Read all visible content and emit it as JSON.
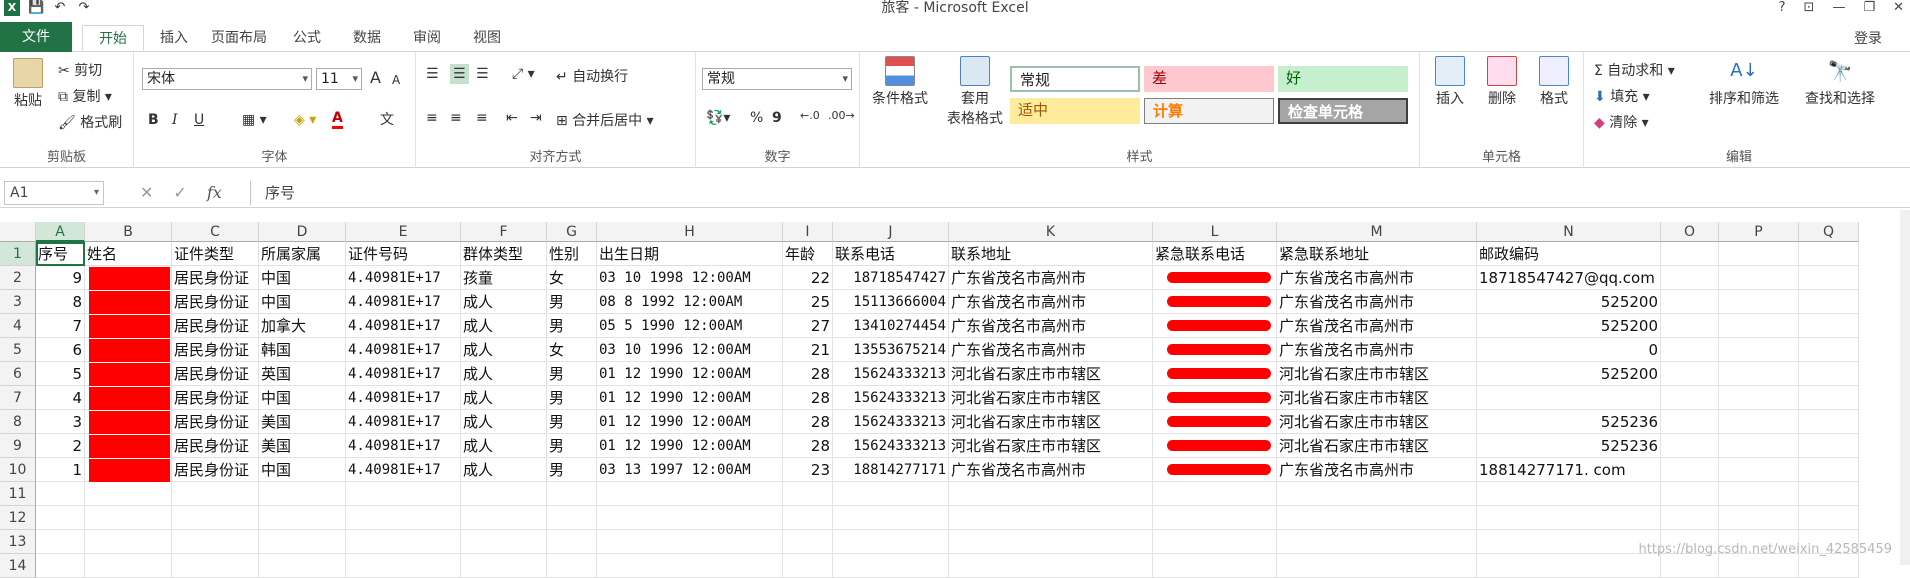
{
  "title_bar": {
    "title": "旅客 - Microsoft Excel",
    "help": "?",
    "ribbon_opts": "⊡",
    "minimize": "—",
    "restore": "❐",
    "close": "✕"
  },
  "tabs": {
    "file": "文件",
    "items": [
      "开始",
      "插入",
      "页面布局",
      "公式",
      "数据",
      "审阅",
      "视图"
    ],
    "login": "登录"
  },
  "ribbon": {
    "clipboard": {
      "paste": "粘贴",
      "cut": "剪切",
      "copy": "复制",
      "format_painter": "格式刷",
      "label": "剪贴板"
    },
    "font": {
      "name": "宋体",
      "size": "11",
      "grow": "A",
      "shrink": "A",
      "bold": "B",
      "italic": "I",
      "underline": "U",
      "wen": "文",
      "label": "字体"
    },
    "alignment": {
      "wrap": "自动换行",
      "merge": "合并后居中",
      "label": "对齐方式"
    },
    "number": {
      "format": "常规",
      "currency": "%",
      "comma": "9",
      "label": "数字"
    },
    "styles": {
      "conditional": "条件格式",
      "table1": "套用",
      "table2": "表格格式",
      "normal": "常规",
      "bad": "差",
      "good": "好",
      "neutral": "适中",
      "calc": "计算",
      "check": "检查单元格",
      "label": "样式"
    },
    "cells": {
      "insert": "插入",
      "delete": "删除",
      "format": "格式",
      "label": "单元格"
    },
    "editing": {
      "autosum": "自动求和",
      "fill": "填充",
      "clear": "清除",
      "sort": "排序和筛选",
      "find": "查找和选择",
      "label": "编辑"
    }
  },
  "formula_bar": {
    "name_box": "A1",
    "fx": "fx",
    "content": "序号"
  },
  "columns": [
    "A",
    "B",
    "C",
    "D",
    "E",
    "F",
    "G",
    "H",
    "I",
    "J",
    "K",
    "L",
    "M",
    "N",
    "O",
    "P",
    "Q"
  ],
  "rows": [
    "1",
    "2",
    "3",
    "4",
    "5",
    "6",
    "7",
    "8",
    "9",
    "10",
    "11",
    "12",
    "13",
    "14"
  ],
  "header_row": [
    "序号",
    "姓名",
    "证件类型",
    "所属家属",
    "证件号码",
    "群体类型",
    "性别",
    "出生日期",
    "年龄",
    "联系电话",
    "联系地址",
    "紧急联系电话",
    "紧急联系地址",
    "邮政编码"
  ],
  "data_rows": [
    [
      "9",
      "",
      "居民身份证",
      "中国",
      "4.40981E+17",
      "孩童",
      "女",
      "03 10 1998 12:00AM",
      "22",
      "18718547427",
      "广东省茂名市高州市",
      "",
      "广东省茂名市高州市",
      "18718547427@qq.com"
    ],
    [
      "8",
      "",
      "居民身份证",
      "中国",
      "4.40981E+17",
      "成人",
      "男",
      "08  8 1992 12:00AM",
      "25",
      "15113666004",
      "广东省茂名市高州市",
      "",
      "广东省茂名市高州市",
      "525200"
    ],
    [
      "7",
      "",
      "居民身份证",
      "加拿大",
      "4.40981E+17",
      "成人",
      "男",
      "05  5 1990 12:00AM",
      "27",
      "13410274454",
      "广东省茂名市高州市",
      "",
      "广东省茂名市高州市",
      "525200"
    ],
    [
      "6",
      "",
      "居民身份证",
      "韩国",
      "4.40981E+17",
      "成人",
      "女",
      "03 10 1996 12:00AM",
      "21",
      "13553675214",
      "广东省茂名市高州市",
      "",
      "广东省茂名市高州市",
      "0"
    ],
    [
      "5",
      "",
      "居民身份证",
      "英国",
      "4.40981E+17",
      "成人",
      "男",
      "01 12 1990 12:00AM",
      "28",
      "15624333213",
      "河北省石家庄市市辖区",
      "",
      "河北省石家庄市市辖区",
      "525200"
    ],
    [
      "4",
      "",
      "居民身份证",
      "中国",
      "4.40981E+17",
      "成人",
      "男",
      "01 12 1990 12:00AM",
      "28",
      "15624333213",
      "河北省石家庄市市辖区",
      "",
      "河北省石家庄市市辖区",
      ""
    ],
    [
      "3",
      "",
      "居民身份证",
      "美国",
      "4.40981E+17",
      "成人",
      "男",
      "01 12 1990 12:00AM",
      "28",
      "15624333213",
      "河北省石家庄市市辖区",
      "",
      "河北省石家庄市市辖区",
      "525236"
    ],
    [
      "2",
      "",
      "居民身份证",
      "美国",
      "4.40981E+17",
      "成人",
      "男",
      "01 12 1990 12:00AM",
      "28",
      "15624333213",
      "河北省石家庄市市辖区",
      "",
      "河北省石家庄市市辖区",
      "525236"
    ],
    [
      "1",
      "",
      "居民身份证",
      "中国",
      "4.40981E+17",
      "成人",
      "男",
      "03 13 1997 12:00AM",
      "23",
      "18814277171",
      "广东省茂名市高州市",
      "",
      "广东省茂名市高州市",
      "18814277171. com"
    ]
  ],
  "watermark": "https://blog.csdn.net/weixin_42585459",
  "colors": {
    "excel_green": "#217346",
    "redaction": "#ff0000",
    "good_bg": "#c6efce",
    "bad_bg": "#ffc7ce",
    "neutral_bg": "#ffeb9c"
  }
}
